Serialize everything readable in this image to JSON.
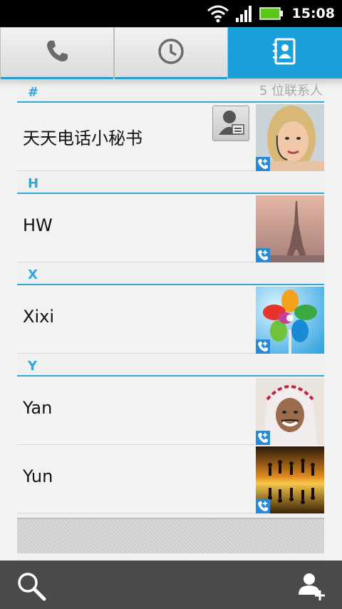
{
  "status_bar": {
    "time": "15:08",
    "icons": [
      "wifi-icon",
      "signal-icon",
      "battery-icon"
    ],
    "battery_color": "#5cc61b"
  },
  "tabs": [
    {
      "icon": "phone-icon",
      "active": false
    },
    {
      "icon": "clock-icon",
      "active": false
    },
    {
      "icon": "contacts-book-icon",
      "active": true
    }
  ],
  "accent_color": "#2fa7d8",
  "contact_count": "5 位联系人",
  "sections": [
    {
      "letter": "#",
      "contacts": [
        {
          "name": "天天电话小秘书",
          "photo": "woman-headset-photo",
          "quick_contact": true
        }
      ]
    },
    {
      "letter": "H",
      "contacts": [
        {
          "name": "HW",
          "photo": "eiffel-tower-photo"
        }
      ]
    },
    {
      "letter": "X",
      "contacts": [
        {
          "name": "Xixi",
          "photo": "pinwheel-photo"
        }
      ]
    },
    {
      "letter": "Y",
      "contacts": [
        {
          "name": "Yan",
          "photo": "man-keffiyeh-photo"
        },
        {
          "name": "Yun",
          "photo": "sunset-silhouettes-photo"
        }
      ]
    }
  ],
  "bottom_bar": {
    "left_icon": "search-icon",
    "right_icon": "add-contact-icon"
  }
}
